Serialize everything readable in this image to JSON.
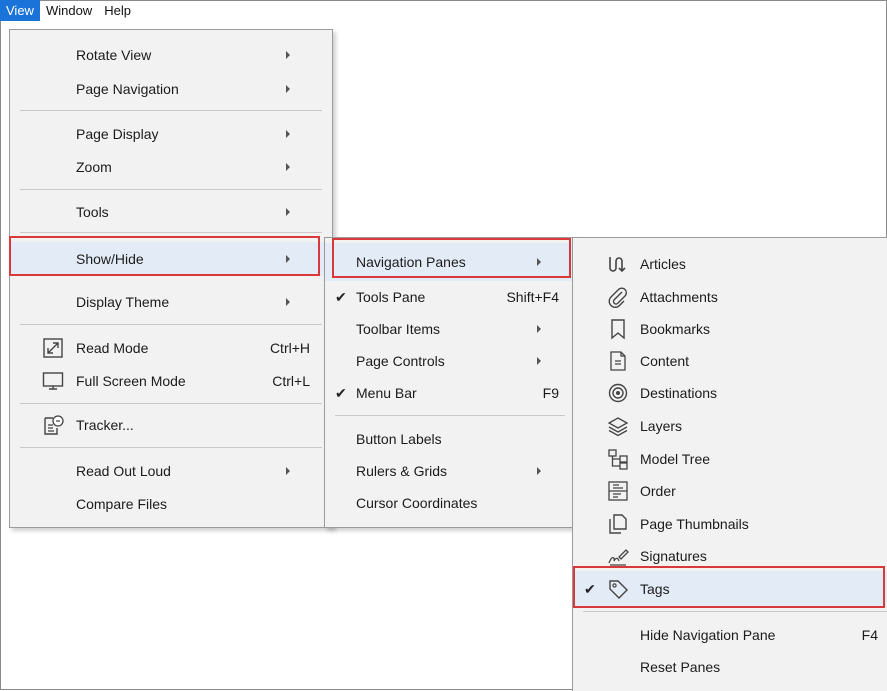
{
  "menubar": {
    "items": [
      "View",
      "Window",
      "Help"
    ]
  },
  "view_menu": {
    "items": [
      {
        "label": "Rotate View",
        "submenu": true
      },
      {
        "label": "Page Navigation",
        "submenu": true
      },
      {
        "label": "Page Display",
        "submenu": true
      },
      {
        "label": "Zoom",
        "submenu": true
      },
      {
        "label": "Tools",
        "submenu": true
      },
      {
        "label": "Show/Hide",
        "submenu": true,
        "highlighted": true
      },
      {
        "label": "Display Theme",
        "submenu": true
      },
      {
        "label": "Read Mode",
        "shortcut": "Ctrl+H",
        "icon": "read-mode-icon"
      },
      {
        "label": "Full Screen Mode",
        "shortcut": "Ctrl+L",
        "icon": "monitor-icon"
      },
      {
        "label": "Tracker...",
        "icon": "tracker-icon"
      },
      {
        "label": "Read Out Loud",
        "submenu": true
      },
      {
        "label": "Compare Files"
      }
    ]
  },
  "showhide_menu": {
    "items": [
      {
        "label": "Navigation Panes",
        "submenu": true,
        "highlighted": true
      },
      {
        "label": "Tools Pane",
        "shortcut": "Shift+F4",
        "checked": true
      },
      {
        "label": "Toolbar Items",
        "submenu": true
      },
      {
        "label": "Page Controls",
        "submenu": true
      },
      {
        "label": "Menu Bar",
        "shortcut": "F9",
        "checked": true
      },
      {
        "label": "Button Labels"
      },
      {
        "label": "Rulers & Grids",
        "submenu": true
      },
      {
        "label": "Cursor Coordinates"
      }
    ]
  },
  "navpanes_menu": {
    "items": [
      {
        "label": "Articles",
        "icon": "articles-icon"
      },
      {
        "label": "Attachments",
        "icon": "paperclip-icon"
      },
      {
        "label": "Bookmarks",
        "icon": "bookmark-icon"
      },
      {
        "label": "Content",
        "icon": "content-icon"
      },
      {
        "label": "Destinations",
        "icon": "destinations-icon"
      },
      {
        "label": "Layers",
        "icon": "layers-icon"
      },
      {
        "label": "Model Tree",
        "icon": "model-tree-icon"
      },
      {
        "label": "Order",
        "icon": "order-icon"
      },
      {
        "label": "Page Thumbnails",
        "icon": "page-thumbnails-icon"
      },
      {
        "label": "Signatures",
        "icon": "signature-icon"
      },
      {
        "label": "Tags",
        "icon": "tag-icon",
        "checked": true,
        "highlighted": true
      },
      {
        "label": "Hide Navigation Pane",
        "shortcut": "F4"
      },
      {
        "label": "Reset Panes"
      }
    ]
  },
  "colors": {
    "highlight": "#e3ecf6",
    "annotation_box": "#d9393b",
    "menubar_active": "#1a73d8"
  },
  "check_glyph": "✔"
}
